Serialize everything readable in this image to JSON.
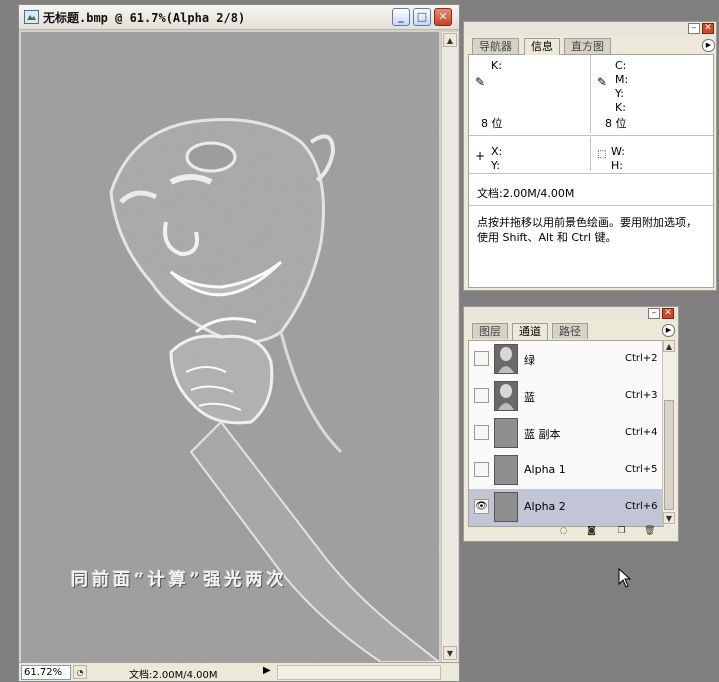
{
  "document": {
    "title": "无标题.bmp @ 61.7%(Alpha 2/8)",
    "caption": "同前面“计算”强光两次",
    "zoom": "61.72%",
    "doc_size": "文档:2.00M/4.00M"
  },
  "info_panel": {
    "tabs": [
      "导航器",
      "信息",
      "直方图"
    ],
    "active_tab": "信息",
    "left_readout": {
      "k_label": "K:",
      "bits": "8 位"
    },
    "right_readout": {
      "c_label": "C:",
      "m_label": "M:",
      "y_label": "Y:",
      "k_label": "K:",
      "bits": "8 位"
    },
    "coords": {
      "x_label": "X:",
      "y_label": "Y:",
      "w_label": "W:",
      "h_label": "H:"
    },
    "doc_size": "文档:2.00M/4.00M",
    "hint": "点按并拖移以用前景色绘画。要用附加选项，使用 Shift、Alt 和 Ctrl 键。"
  },
  "channels_panel": {
    "tabs": [
      "图层",
      "通道",
      "路径"
    ],
    "active_tab": "通道",
    "channels": [
      {
        "name": "绿",
        "shortcut": "Ctrl+2",
        "visible": false,
        "selected": false,
        "thumb": "photo"
      },
      {
        "name": "蓝",
        "shortcut": "Ctrl+3",
        "visible": false,
        "selected": false,
        "thumb": "photo"
      },
      {
        "name": "蓝 副本",
        "shortcut": "Ctrl+4",
        "visible": false,
        "selected": false,
        "thumb": "gray"
      },
      {
        "name": "Alpha 1",
        "shortcut": "Ctrl+5",
        "visible": false,
        "selected": false,
        "thumb": "gray"
      },
      {
        "name": "Alpha 2",
        "shortcut": "Ctrl+6",
        "visible": true,
        "selected": true,
        "thumb": "gray"
      }
    ]
  },
  "colors": {
    "workspace": "#7f7f7f",
    "canvas": "#9c9c9c",
    "selected_row": "#c1c5d6"
  }
}
